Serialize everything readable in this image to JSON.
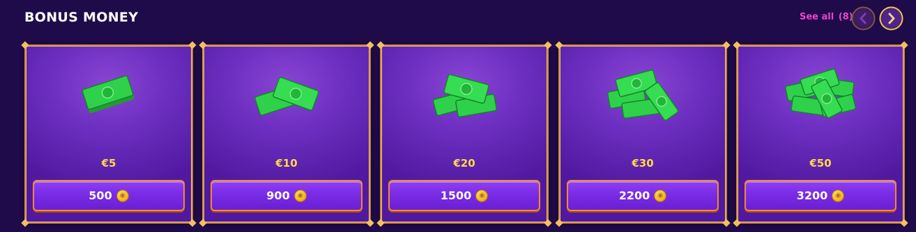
{
  "section": {
    "title": "BONUS MONEY",
    "see_all_label": "See all",
    "see_all_count": "(8)"
  },
  "navigation": {
    "prev_icon": "chevron-left-icon",
    "next_icon": "chevron-right-icon"
  },
  "colors": {
    "accent_pink": "#ee44c9",
    "price_gold": "#ffd94a",
    "button_purple": "#7a2ce6",
    "button_border": "#f48a2e",
    "background": "#1f0a4a"
  },
  "cards": [
    {
      "price": "€5",
      "cost": "500",
      "icon": "cash-stack-icon"
    },
    {
      "price": "€10",
      "cost": "900",
      "icon": "cash-stack-icon"
    },
    {
      "price": "€20",
      "cost": "1500",
      "icon": "cash-stack-icon"
    },
    {
      "price": "€30",
      "cost": "2200",
      "icon": "cash-stack-icon"
    },
    {
      "price": "€50",
      "cost": "3200",
      "icon": "cash-stack-icon"
    }
  ],
  "coin_icon": "gold-coin-icon"
}
